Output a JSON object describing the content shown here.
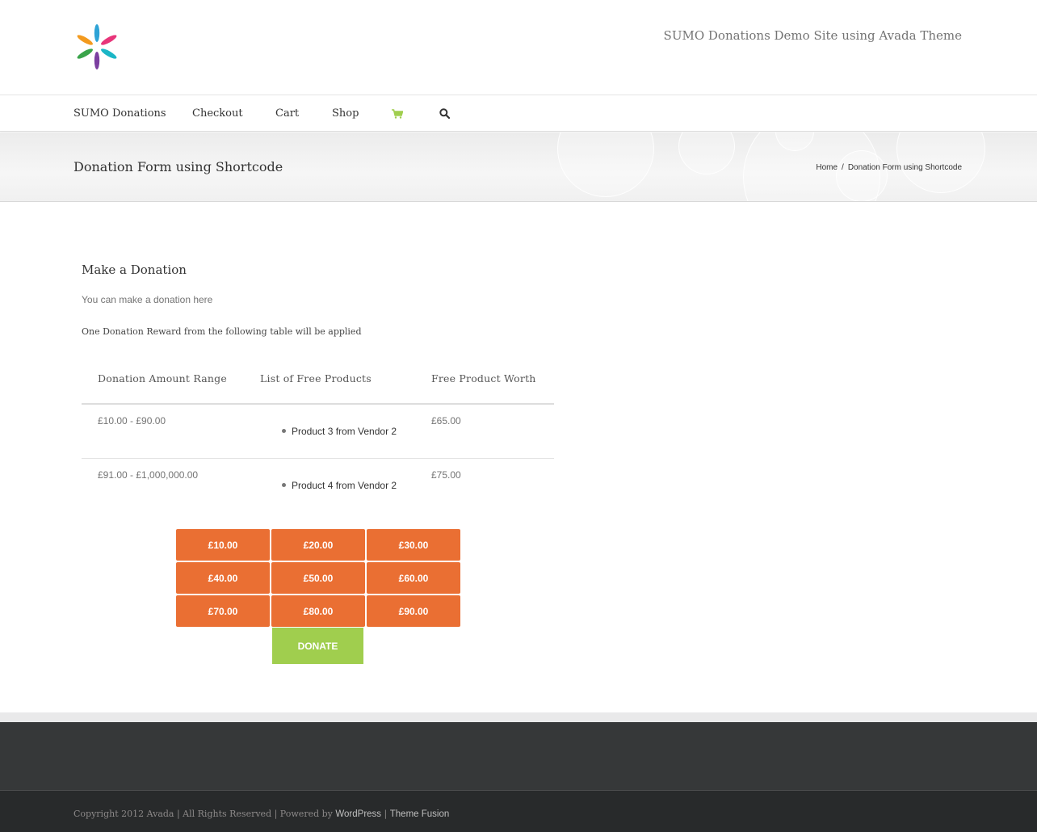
{
  "header": {
    "tagline": "SUMO Donations Demo Site using Avada Theme",
    "logo_icon": "flower-logo-icon"
  },
  "nav": {
    "items": [
      {
        "label": "SUMO Donations"
      },
      {
        "label": "Checkout"
      },
      {
        "label": "Cart"
      },
      {
        "label": "Shop"
      }
    ],
    "cart_icon": "cart-icon",
    "search_icon": "search-icon",
    "cart_icon_color": "#a0ce4e"
  },
  "titlebar": {
    "title": "Donation Form using Shortcode",
    "breadcrumb": {
      "home": "Home",
      "separator": "/",
      "current": "Donation Form using Shortcode"
    }
  },
  "donation": {
    "heading": "Make a Donation",
    "intro": "You can make a donation here",
    "reward_note": "One Donation Reward from the following table will be applied",
    "table": {
      "headers": [
        "Donation Amount Range",
        "List of Free Products",
        "Free Product Worth"
      ],
      "rows": [
        {
          "range": "£10.00 - £90.00",
          "product": "Product 3 from Vendor 2",
          "worth": "£65.00"
        },
        {
          "range": "£91.00 - £1,000,000.00",
          "product": "Product 4 from Vendor 2",
          "worth": "£75.00"
        }
      ]
    },
    "amounts": [
      "£10.00",
      "£20.00",
      "£30.00",
      "£40.00",
      "£50.00",
      "£60.00",
      "£70.00",
      "£80.00",
      "£90.00"
    ],
    "donate_label": "DONATE",
    "amount_button_color": "#ea6f33",
    "donate_button_color": "#a0ce4e"
  },
  "footer": {
    "copyright_text": "Copyright 2012 Avada | All Rights Reserved | Powered by ",
    "wordpress_link": "WordPress",
    "separator": " | ",
    "themefusion_link": "Theme Fusion"
  }
}
